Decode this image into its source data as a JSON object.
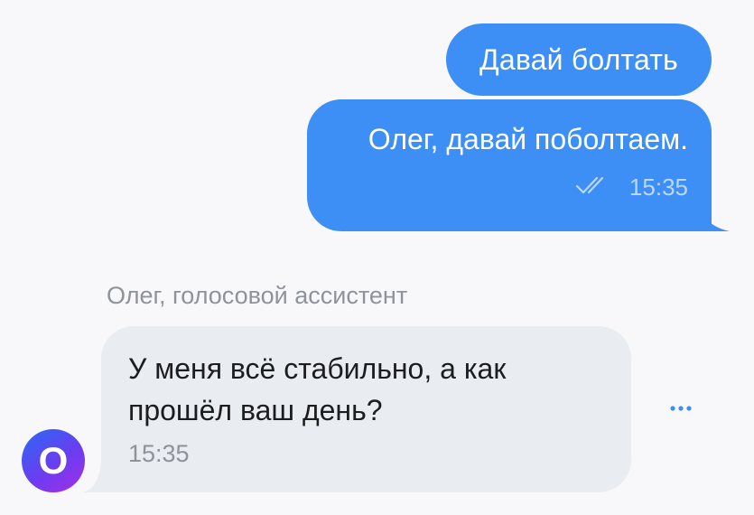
{
  "messages": {
    "outgoing": [
      {
        "text": "Давай болтать"
      },
      {
        "text": "Олег, давай поболтаем.",
        "time": "15:35",
        "status_icon": "double-check-icon"
      }
    ],
    "incoming": {
      "sender": "Олег, голосовой ассистент",
      "text": "У меня всё стабильно, а как прошёл ваш день?",
      "time": "15:35",
      "avatar_letter": "О"
    }
  },
  "actions": {
    "more_icon": "more-dots-icon"
  },
  "colors": {
    "background": "#f8f8fa",
    "outgoing_bubble": "#3d8ef5",
    "incoming_bubble": "#e9ecf0",
    "secondary_text": "#8e939b",
    "accent": "#3d8ef5"
  }
}
